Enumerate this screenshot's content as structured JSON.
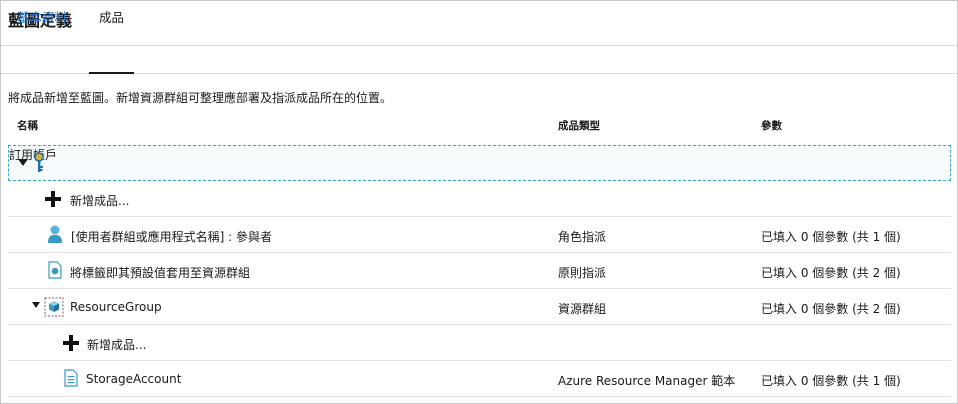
{
  "title": "藍圖定義",
  "tabs": [
    {
      "label": "基本資料"
    },
    {
      "label": "成品"
    }
  ],
  "description": "將成品新增至藍圖。新增資源群組可整理應部署及指派成品所在的位置。",
  "columns": {
    "name": "名稱",
    "type": "成品類型",
    "params": "參數"
  },
  "rows": [
    {
      "name": "訂用帳戶",
      "type": "",
      "params": ""
    },
    {
      "name": "新增成品...",
      "type": "",
      "params": ""
    },
    {
      "name": "[使用者群組或應用程式名稱] : 參與者",
      "type": "角色指派",
      "params": "已填入 0 個參數 (共 1 個)"
    },
    {
      "name": "將標籤即其預設值套用至資源群組",
      "type": "原則指派",
      "params": "已填入 0 個參數 (共 2 個)"
    },
    {
      "name": "ResourceGroup",
      "type": "資源群組",
      "params": "已填入 0 個參數 (共 2 個)"
    },
    {
      "name": "新增成品...",
      "type": "",
      "params": ""
    },
    {
      "name": "StorageAccount",
      "type": "Azure Resource Manager 範本",
      "params": "已填入 0 個參數 (共 1 個)"
    }
  ],
  "icons": {
    "subscription": "key-icon",
    "add": "plus-icon",
    "role": "user-icon",
    "policy": "policy-document-icon",
    "resource_group": "resource-group-cube-icon",
    "template": "template-document-icon"
  },
  "colors": {
    "accent": "#2673c9",
    "icon_blue": "#3999c6",
    "selection_border": "#3aa6c9"
  }
}
